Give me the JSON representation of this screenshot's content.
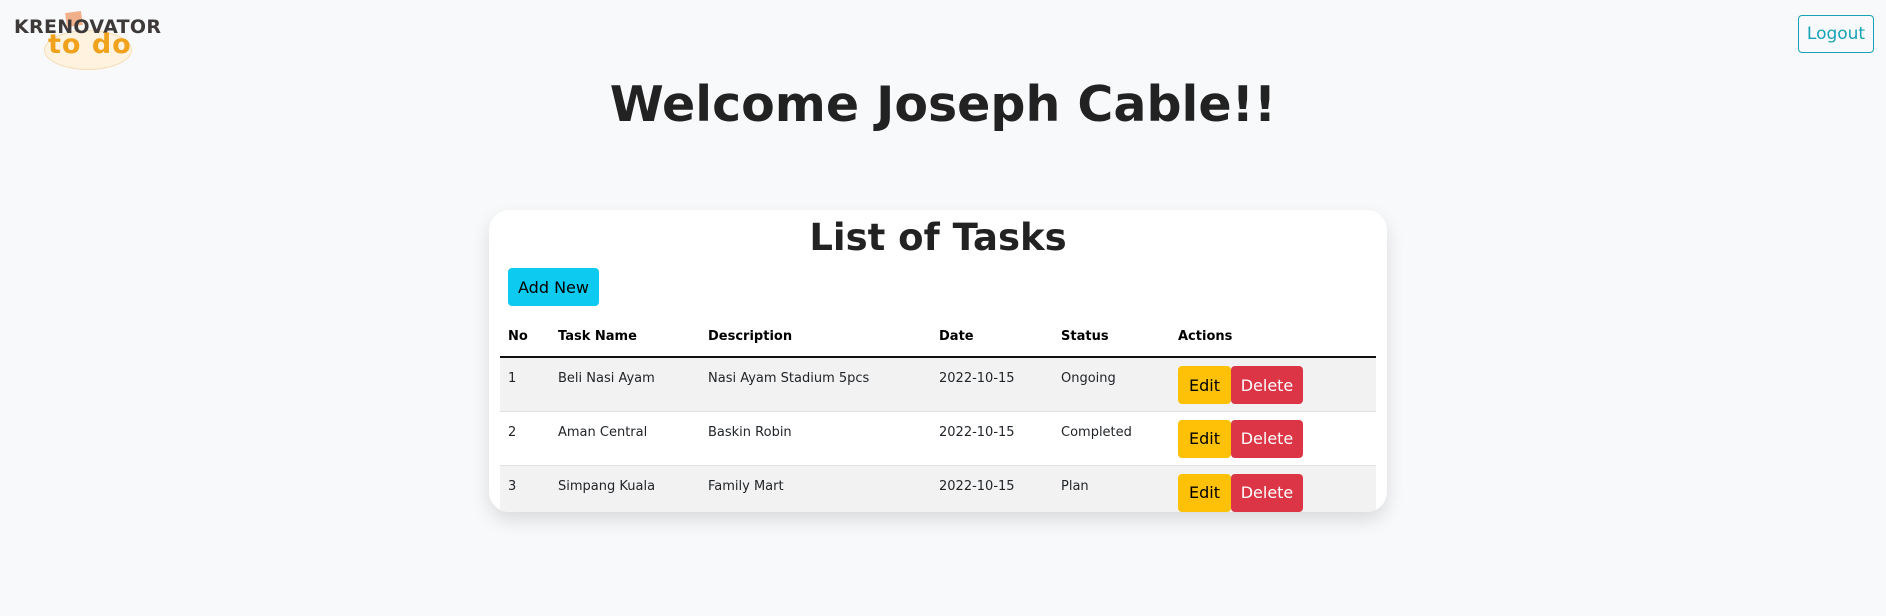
{
  "logo": {
    "main_text": "KRENOVATOR",
    "sub_text": "to do"
  },
  "header": {
    "logout_label": "Logout",
    "welcome_text": "Welcome Joseph Cable!!"
  },
  "card": {
    "title": "List of Tasks",
    "add_new_label": "Add New",
    "columns": [
      "No",
      "Task Name",
      "Description",
      "Date",
      "Status",
      "Actions"
    ],
    "rows": [
      {
        "no": "1",
        "task_name": "Beli Nasi Ayam",
        "description": "Nasi Ayam Stadium 5pcs",
        "date": "2022-10-15",
        "status": "Ongoing",
        "edit_label": "Edit",
        "delete_label": "Delete"
      },
      {
        "no": "2",
        "task_name": "Aman Central",
        "description": "Baskin Robin",
        "date": "2022-10-15",
        "status": "Completed",
        "edit_label": "Edit",
        "delete_label": "Delete"
      },
      {
        "no": "3",
        "task_name": "Simpang Kuala",
        "description": "Family Mart",
        "date": "2022-10-15",
        "status": "Plan",
        "edit_label": "Edit",
        "delete_label": "Delete"
      }
    ]
  },
  "colors": {
    "page_background": "#f8f9fa",
    "info": "#17a2b8",
    "add_button": "#0dcaf0",
    "edit_button": "#ffc107",
    "delete_button": "#dc3545",
    "logo_accent": "#f0a21d"
  }
}
